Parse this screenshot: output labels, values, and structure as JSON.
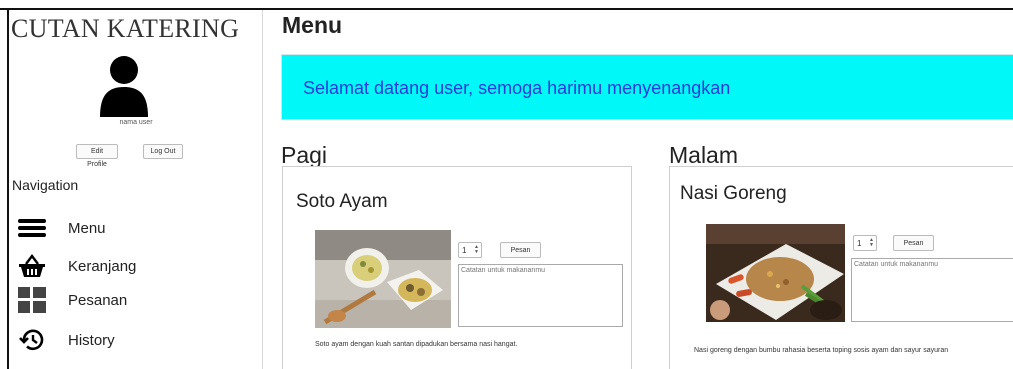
{
  "sidebar": {
    "brand": "CUTAN KATERING",
    "user_name": "nama user",
    "edit_profile_label": "Edit Profile",
    "logout_label": "Log Out",
    "nav_heading": "Navigation",
    "items": [
      {
        "label": "Menu",
        "icon": "hamburger-icon"
      },
      {
        "label": "Keranjang",
        "icon": "basket-icon"
      },
      {
        "label": "Pesanan",
        "icon": "grid-icon"
      },
      {
        "label": "History",
        "icon": "history-icon"
      }
    ]
  },
  "main": {
    "title": "Menu",
    "welcome": "Selamat datang user, semoga harimu menyenangkan",
    "accent_color": "#00f8f8",
    "welcome_text_color": "#2b3bd8",
    "sections": [
      {
        "title": "Pagi",
        "card": {
          "name": "Soto Ayam",
          "quantity": "1",
          "order_label": "Pesan",
          "notes_placeholder": "Catatan untuk makananmu",
          "description": "Soto ayam dengan kuah santan dipadukan bersama nasi hangat."
        }
      },
      {
        "title": "Malam",
        "card": {
          "name": "Nasi Goreng",
          "quantity": "1",
          "order_label": "Pesan",
          "notes_placeholder": "Catatan untuk makananmu",
          "description": "Nasi goreng dengan bumbu rahasia beserta toping sosis ayam dan sayur sayuran"
        }
      }
    ]
  }
}
